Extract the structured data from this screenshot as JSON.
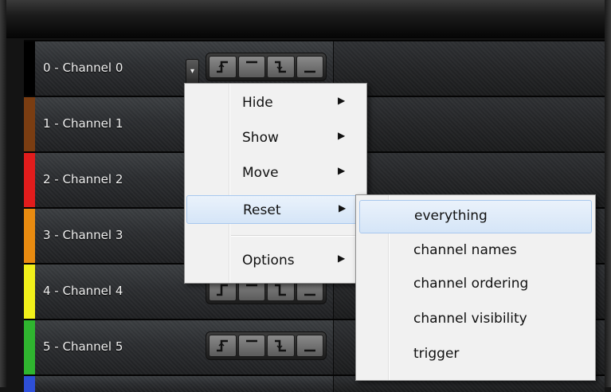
{
  "channels": [
    {
      "label": "0 - Channel 0",
      "color": "#000000"
    },
    {
      "label": "1 - Channel 1",
      "color": "#7a3d12"
    },
    {
      "label": "2 - Channel 2",
      "color": "#e21c1c"
    },
    {
      "label": "3 - Channel 3",
      "color": "#e98b10"
    },
    {
      "label": "4 - Channel 4",
      "color": "#f1f01a"
    },
    {
      "label": "5 - Channel 5",
      "color": "#2fb52f"
    }
  ],
  "trigger_buttons": [
    "rising-edge-icon",
    "high-level-icon",
    "falling-edge-icon",
    "low-level-icon"
  ],
  "context_menu": {
    "items": [
      {
        "label": "Hide",
        "has_submenu": true
      },
      {
        "label": "Show",
        "has_submenu": true
      },
      {
        "label": "Move",
        "has_submenu": true
      },
      {
        "label": "Reset",
        "has_submenu": true,
        "highlighted": true
      },
      {
        "label": "Options",
        "has_submenu": true
      }
    ],
    "arrow_glyph": "▶"
  },
  "reset_submenu": {
    "items": [
      {
        "label": "everything",
        "highlighted": true
      },
      {
        "label": "channel names"
      },
      {
        "label": "channel ordering"
      },
      {
        "label": "channel visibility"
      },
      {
        "label": "trigger"
      }
    ]
  },
  "colors": {
    "menu_bg": "#f1f1f1",
    "highlight_border": "#a8c8ee",
    "panel_bg": "#2a2c2f"
  }
}
